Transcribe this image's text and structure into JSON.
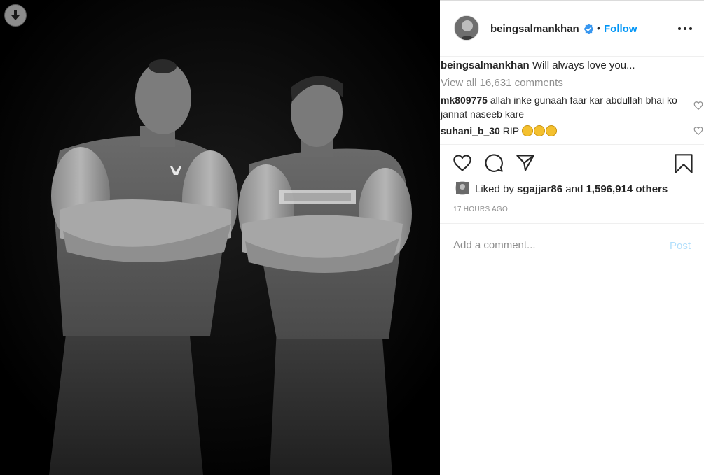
{
  "post": {
    "username": "beingsalmankhan",
    "follow_label": "Follow",
    "dot": "•",
    "caption_user": "beingsalmankhan",
    "caption_text": " Will always love you...",
    "view_all": "View all 16,631 comments",
    "comments": [
      {
        "user": "mk809775",
        "text": " allah inke gunaah faar kar abdullah bhai ko jannat naseeb kare"
      },
      {
        "user": "suhani_b_30",
        "text": " RIP"
      }
    ],
    "liked_prefix": "Liked by ",
    "liked_user": "sgajjar86",
    "liked_and": " and ",
    "liked_count": "1,596,914 others",
    "time": "17 HOURS AGO",
    "comment_placeholder": "Add a comment...",
    "post_label": "Post"
  },
  "colors": {
    "accent": "#0095f6",
    "post_disabled": "#b2dffc",
    "muted": "#8e8e8e",
    "text": "#262626"
  },
  "icons": {
    "download": "download-arrow-icon",
    "verified": "verified-badge-icon",
    "more": "more-options-icon",
    "like": "heart-icon",
    "comment": "comment-bubble-icon",
    "share": "paper-plane-icon",
    "save": "bookmark-icon"
  }
}
